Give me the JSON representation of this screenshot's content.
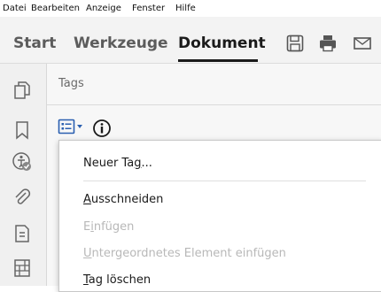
{
  "menubar": {
    "items": [
      "Datei",
      "Bearbeiten",
      "Anzeige",
      "Fenster",
      "Hilfe"
    ]
  },
  "toolbar": {
    "tabs": [
      "Start",
      "Werkzeuge",
      "Dokument"
    ],
    "active_tab": "Dokument",
    "icons": [
      "save-icon",
      "print-icon",
      "email-icon"
    ]
  },
  "left_rail": {
    "icons": [
      "pages-icon",
      "bookmark-icon",
      "accessibility-check-icon",
      "attachment-icon",
      "document-info-icon",
      "layers-icon"
    ]
  },
  "panel": {
    "title": "Tags",
    "options_icon": "list-options-icon",
    "info_icon": "info-icon"
  },
  "context_menu": {
    "items": [
      {
        "pre": "Neuer Ta",
        "ul": "g",
        "post": "...",
        "disabled": false
      },
      {
        "pre": "",
        "ul": "A",
        "post": "usschneiden",
        "disabled": false
      },
      {
        "pre": "E",
        "ul": "i",
        "post": "nfügen",
        "disabled": true
      },
      {
        "pre": "",
        "ul": "U",
        "post": "ntergeordnetes Element einfügen",
        "disabled": true
      },
      {
        "pre": "",
        "ul": "T",
        "post": "ag löschen",
        "disabled": false
      }
    ]
  },
  "colors": {
    "accent_blue": "#2a5fb0",
    "text": "#1a1a1a",
    "disabled_text": "#b8b8b8"
  }
}
